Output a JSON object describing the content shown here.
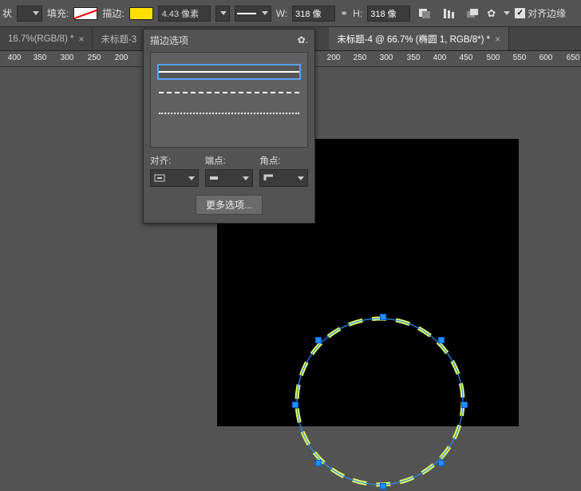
{
  "option_bar": {
    "shape_label": "状",
    "fill_label": "填充:",
    "stroke_label": "描边:",
    "stroke_width": "4.43 像素",
    "w_label": "W:",
    "w_value": "318 像",
    "h_label": "H:",
    "h_value": "318 像",
    "align_edges_label": "对齐边缘"
  },
  "tabs": [
    {
      "title": "16.7%(RGB/8) *"
    },
    {
      "title": "未标题-3"
    },
    {
      "title": "未标题-4 @ 66.7% (椭圆 1, RGB/8*) *"
    }
  ],
  "ruler_ticks": [
    "400",
    "350",
    "300",
    "250",
    "200",
    "",
    "",
    "",
    "",
    "",
    "",
    "",
    "200",
    "250",
    "300",
    "350",
    "400",
    "450",
    "500",
    "550",
    "600",
    "650"
  ],
  "popover": {
    "title": "描边选项",
    "align_label": "对齐:",
    "caps_label": "端点:",
    "corner_label": "角点:",
    "more_options": "更多选项..."
  }
}
